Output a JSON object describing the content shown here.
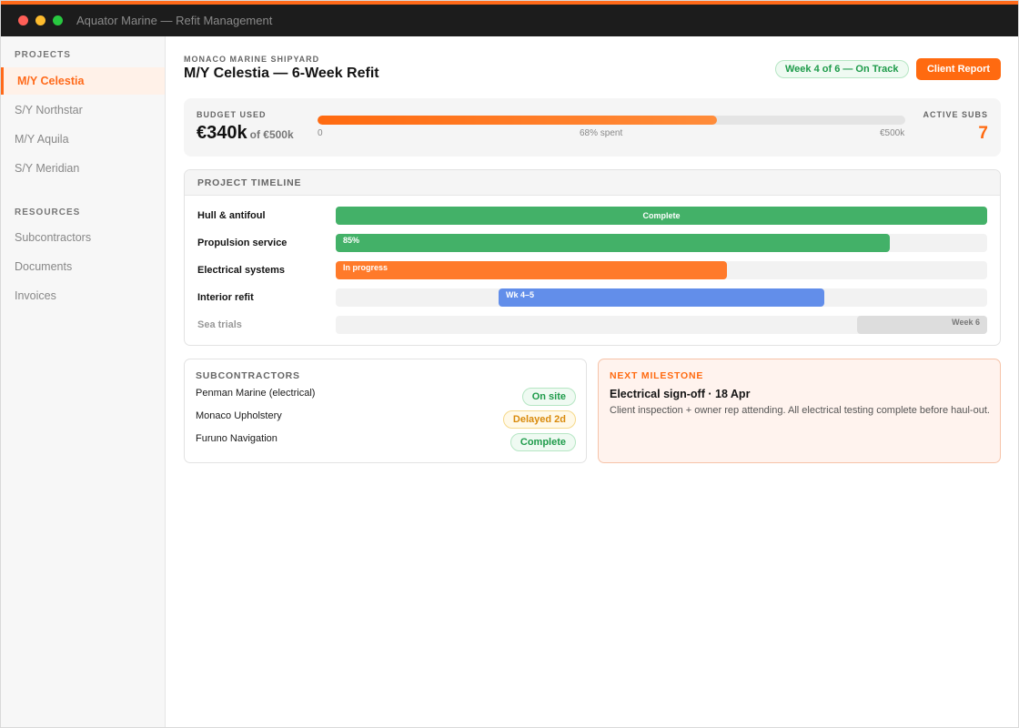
{
  "window": {
    "title": "Aquator Marine — Refit Management"
  },
  "sidebar": {
    "projects_heading": "PROJECTS",
    "projects": [
      {
        "label": "M/Y Celestia",
        "active": true
      },
      {
        "label": "S/Y Northstar",
        "active": false
      },
      {
        "label": "M/Y Aquila",
        "active": false
      },
      {
        "label": "S/Y Meridian",
        "active": false
      }
    ],
    "resources_heading": "RESOURCES",
    "resources": [
      {
        "label": "Subcontractors"
      },
      {
        "label": "Documents"
      },
      {
        "label": "Invoices"
      }
    ]
  },
  "header": {
    "yard": "MONACO MARINE SHIPYARD",
    "title": "M/Y Celestia — 6-Week Refit",
    "status": "Week 4 of 6 — On Track",
    "report_button": "Client Report"
  },
  "budget": {
    "label": "BUDGET USED",
    "amount": "€340k",
    "of_total": "of €500k",
    "fraction_spent": 0.68,
    "scale_min": "0",
    "pct_label": "68% spent",
    "scale_max": "€500k",
    "subs_label": "ACTIVE SUBS",
    "subs_value": "7"
  },
  "timeline": {
    "heading": "PROJECT TIMELINE",
    "rows": [
      {
        "task": "Hull & antifoul",
        "start": 0,
        "end": 1.0,
        "bar_label": "Complete",
        "color": "#43b168",
        "muted": false
      },
      {
        "task": "Propulsion service",
        "start": 0,
        "end": 0.85,
        "bar_label": "85%",
        "color": "#43b168",
        "muted": false
      },
      {
        "task": "Electrical systems",
        "start": 0,
        "end": 0.6,
        "bar_label": "In progress",
        "color": "#ff7a2a",
        "muted": false
      },
      {
        "task": "Interior refit",
        "start": 0.25,
        "end": 0.75,
        "bar_label": "Wk 4–5",
        "color": "#628eea",
        "muted": false
      },
      {
        "task": "Sea trials",
        "start": 0.8,
        "end": 1.0,
        "bar_label": "Week 6",
        "color": "#dddddd",
        "muted": true
      }
    ]
  },
  "subcontractors": {
    "heading": "SUBCONTRACTORS",
    "items": [
      {
        "name": "Penman Marine (electrical)",
        "status": "On site",
        "tone": "green"
      },
      {
        "name": "Monaco Upholstery",
        "status": "Delayed 2d",
        "tone": "amber"
      },
      {
        "name": "Furuno Navigation",
        "status": "Complete",
        "tone": "green"
      }
    ]
  },
  "milestone": {
    "heading": "NEXT MILESTONE",
    "title": "Electrical sign-off · 18 Apr",
    "description": "Client inspection + owner rep attending. All electrical testing complete before haul-out."
  },
  "colors": {
    "accent": "#ff6a10",
    "success": "#1e9b4a",
    "warning": "#d98a0b"
  }
}
